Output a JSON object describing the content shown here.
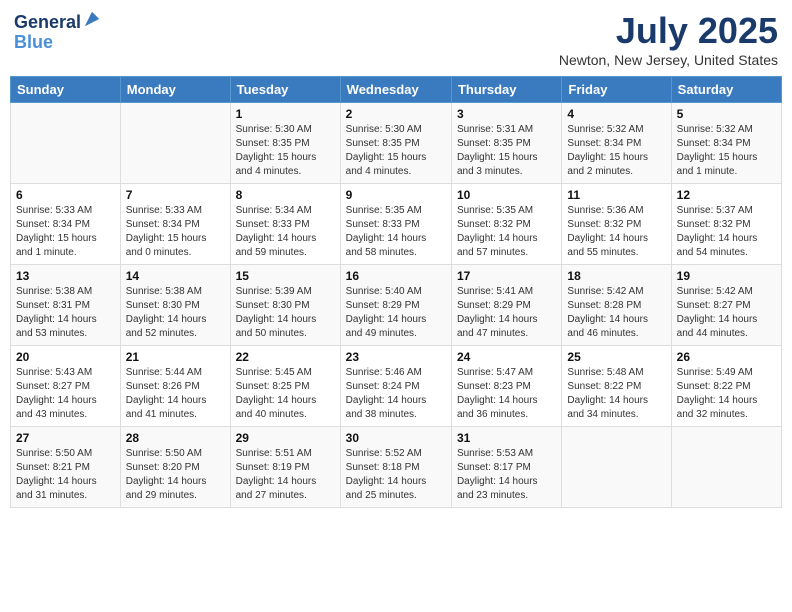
{
  "header": {
    "logo_line1": "General",
    "logo_line2": "Blue",
    "title": "July 2025",
    "subtitle": "Newton, New Jersey, United States"
  },
  "weekdays": [
    "Sunday",
    "Monday",
    "Tuesday",
    "Wednesday",
    "Thursday",
    "Friday",
    "Saturday"
  ],
  "weeks": [
    [
      {
        "day": "",
        "info": ""
      },
      {
        "day": "",
        "info": ""
      },
      {
        "day": "1",
        "info": "Sunrise: 5:30 AM\nSunset: 8:35 PM\nDaylight: 15 hours\nand 4 minutes."
      },
      {
        "day": "2",
        "info": "Sunrise: 5:30 AM\nSunset: 8:35 PM\nDaylight: 15 hours\nand 4 minutes."
      },
      {
        "day": "3",
        "info": "Sunrise: 5:31 AM\nSunset: 8:35 PM\nDaylight: 15 hours\nand 3 minutes."
      },
      {
        "day": "4",
        "info": "Sunrise: 5:32 AM\nSunset: 8:34 PM\nDaylight: 15 hours\nand 2 minutes."
      },
      {
        "day": "5",
        "info": "Sunrise: 5:32 AM\nSunset: 8:34 PM\nDaylight: 15 hours\nand 1 minute."
      }
    ],
    [
      {
        "day": "6",
        "info": "Sunrise: 5:33 AM\nSunset: 8:34 PM\nDaylight: 15 hours\nand 1 minute."
      },
      {
        "day": "7",
        "info": "Sunrise: 5:33 AM\nSunset: 8:34 PM\nDaylight: 15 hours\nand 0 minutes."
      },
      {
        "day": "8",
        "info": "Sunrise: 5:34 AM\nSunset: 8:33 PM\nDaylight: 14 hours\nand 59 minutes."
      },
      {
        "day": "9",
        "info": "Sunrise: 5:35 AM\nSunset: 8:33 PM\nDaylight: 14 hours\nand 58 minutes."
      },
      {
        "day": "10",
        "info": "Sunrise: 5:35 AM\nSunset: 8:32 PM\nDaylight: 14 hours\nand 57 minutes."
      },
      {
        "day": "11",
        "info": "Sunrise: 5:36 AM\nSunset: 8:32 PM\nDaylight: 14 hours\nand 55 minutes."
      },
      {
        "day": "12",
        "info": "Sunrise: 5:37 AM\nSunset: 8:32 PM\nDaylight: 14 hours\nand 54 minutes."
      }
    ],
    [
      {
        "day": "13",
        "info": "Sunrise: 5:38 AM\nSunset: 8:31 PM\nDaylight: 14 hours\nand 53 minutes."
      },
      {
        "day": "14",
        "info": "Sunrise: 5:38 AM\nSunset: 8:30 PM\nDaylight: 14 hours\nand 52 minutes."
      },
      {
        "day": "15",
        "info": "Sunrise: 5:39 AM\nSunset: 8:30 PM\nDaylight: 14 hours\nand 50 minutes."
      },
      {
        "day": "16",
        "info": "Sunrise: 5:40 AM\nSunset: 8:29 PM\nDaylight: 14 hours\nand 49 minutes."
      },
      {
        "day": "17",
        "info": "Sunrise: 5:41 AM\nSunset: 8:29 PM\nDaylight: 14 hours\nand 47 minutes."
      },
      {
        "day": "18",
        "info": "Sunrise: 5:42 AM\nSunset: 8:28 PM\nDaylight: 14 hours\nand 46 minutes."
      },
      {
        "day": "19",
        "info": "Sunrise: 5:42 AM\nSunset: 8:27 PM\nDaylight: 14 hours\nand 44 minutes."
      }
    ],
    [
      {
        "day": "20",
        "info": "Sunrise: 5:43 AM\nSunset: 8:27 PM\nDaylight: 14 hours\nand 43 minutes."
      },
      {
        "day": "21",
        "info": "Sunrise: 5:44 AM\nSunset: 8:26 PM\nDaylight: 14 hours\nand 41 minutes."
      },
      {
        "day": "22",
        "info": "Sunrise: 5:45 AM\nSunset: 8:25 PM\nDaylight: 14 hours\nand 40 minutes."
      },
      {
        "day": "23",
        "info": "Sunrise: 5:46 AM\nSunset: 8:24 PM\nDaylight: 14 hours\nand 38 minutes."
      },
      {
        "day": "24",
        "info": "Sunrise: 5:47 AM\nSunset: 8:23 PM\nDaylight: 14 hours\nand 36 minutes."
      },
      {
        "day": "25",
        "info": "Sunrise: 5:48 AM\nSunset: 8:22 PM\nDaylight: 14 hours\nand 34 minutes."
      },
      {
        "day": "26",
        "info": "Sunrise: 5:49 AM\nSunset: 8:22 PM\nDaylight: 14 hours\nand 32 minutes."
      }
    ],
    [
      {
        "day": "27",
        "info": "Sunrise: 5:50 AM\nSunset: 8:21 PM\nDaylight: 14 hours\nand 31 minutes."
      },
      {
        "day": "28",
        "info": "Sunrise: 5:50 AM\nSunset: 8:20 PM\nDaylight: 14 hours\nand 29 minutes."
      },
      {
        "day": "29",
        "info": "Sunrise: 5:51 AM\nSunset: 8:19 PM\nDaylight: 14 hours\nand 27 minutes."
      },
      {
        "day": "30",
        "info": "Sunrise: 5:52 AM\nSunset: 8:18 PM\nDaylight: 14 hours\nand 25 minutes."
      },
      {
        "day": "31",
        "info": "Sunrise: 5:53 AM\nSunset: 8:17 PM\nDaylight: 14 hours\nand 23 minutes."
      },
      {
        "day": "",
        "info": ""
      },
      {
        "day": "",
        "info": ""
      }
    ]
  ]
}
